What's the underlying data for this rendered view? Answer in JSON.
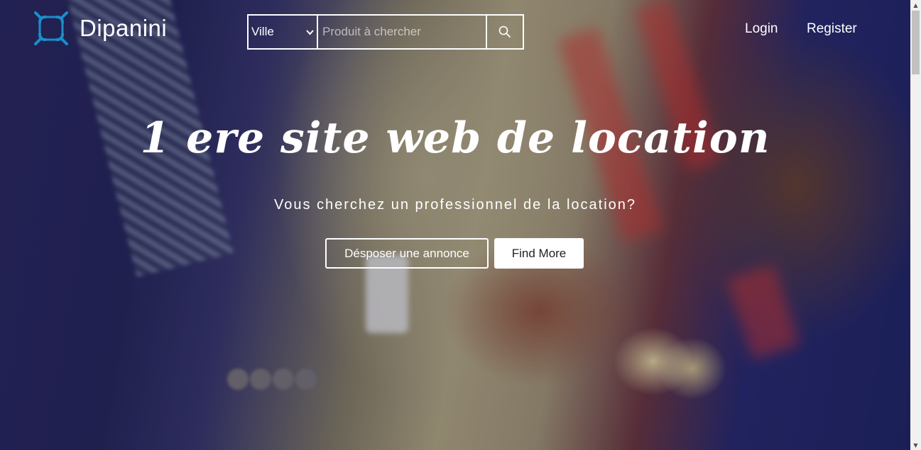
{
  "header": {
    "brand": "Dipanini",
    "logo_icon": "logo-icon",
    "accent_color": "#1a8fc9",
    "city_select": {
      "selected": "Ville"
    },
    "search": {
      "placeholder": "Produit à chercher",
      "icon": "search-icon"
    },
    "nav": {
      "login": "Login",
      "register": "Register"
    }
  },
  "hero": {
    "headline": "1 ere site web de location",
    "subheadline": "Vous cherchez un professionnel de la location?",
    "primary_cta": "Désposer une annonce",
    "secondary_cta": "Find More"
  }
}
